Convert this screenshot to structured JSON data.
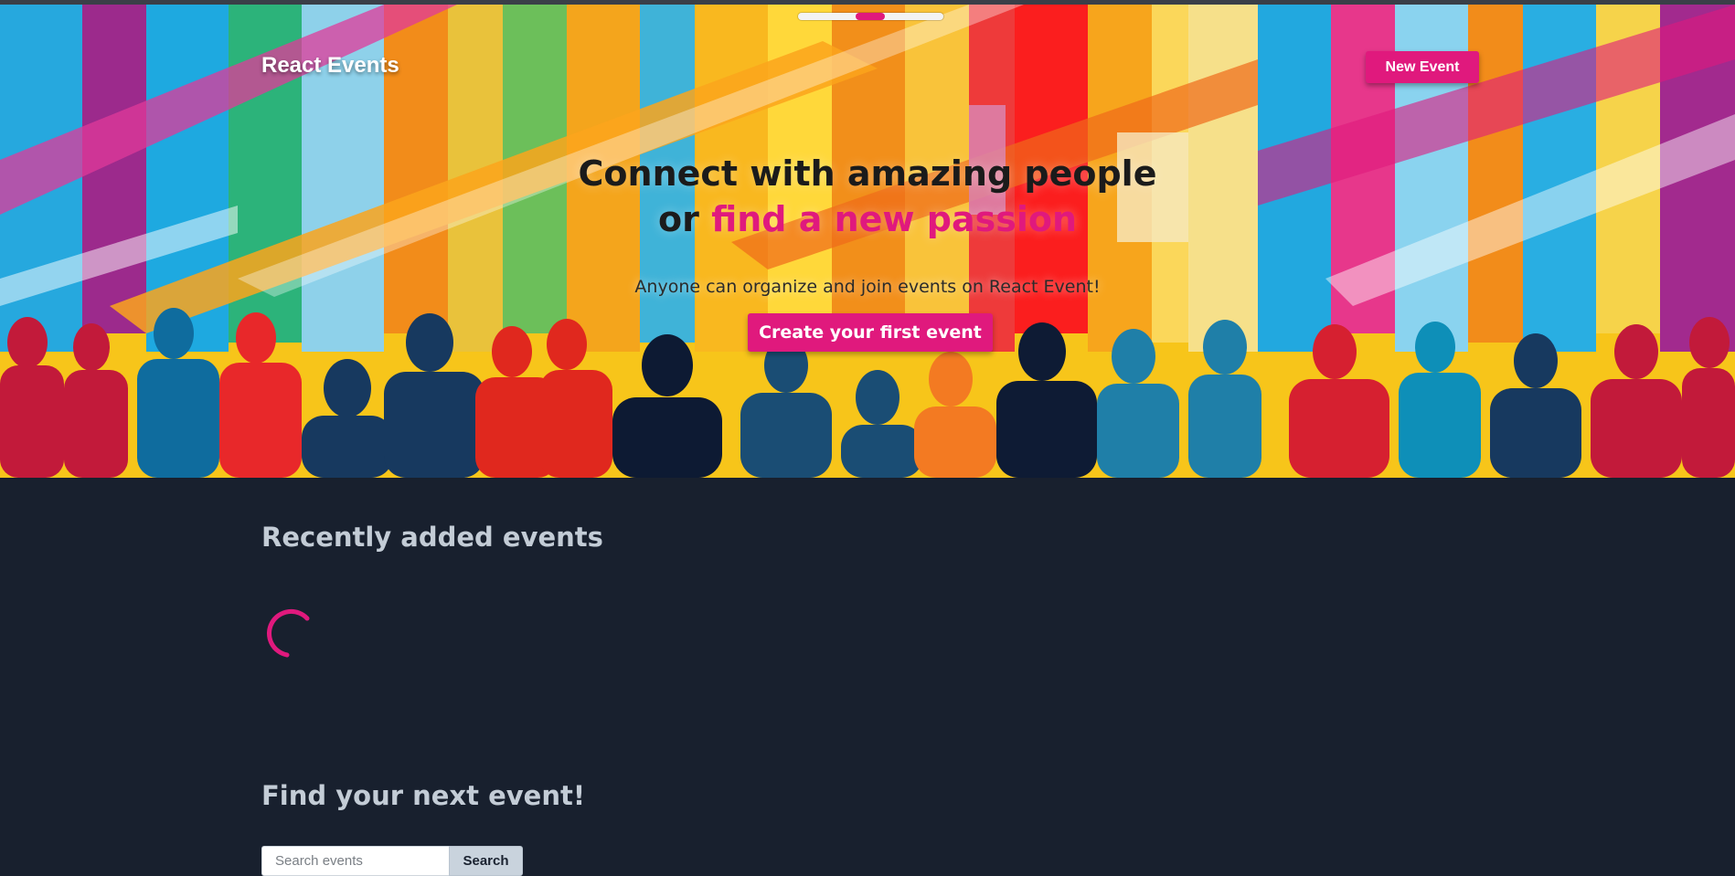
{
  "app": {
    "brand": "React Events",
    "new_event_label": "New Event"
  },
  "hero": {
    "headline_line1": "Connect with amazing people",
    "headline_line2_prefix": "or ",
    "headline_line2_accent": "find a new passion",
    "subtitle": "Anyone can organize and join events on React Event!",
    "cta_label": "Create your first event",
    "carousel_active_index": 1
  },
  "recent": {
    "title": "Recently added events",
    "state": "loading"
  },
  "find": {
    "title": "Find your next event!",
    "search_placeholder": "Search events",
    "search_button_label": "Search"
  },
  "colors": {
    "accent": "#e0197d",
    "page_background": "#18202e",
    "section_title": "#c3ccd6"
  }
}
